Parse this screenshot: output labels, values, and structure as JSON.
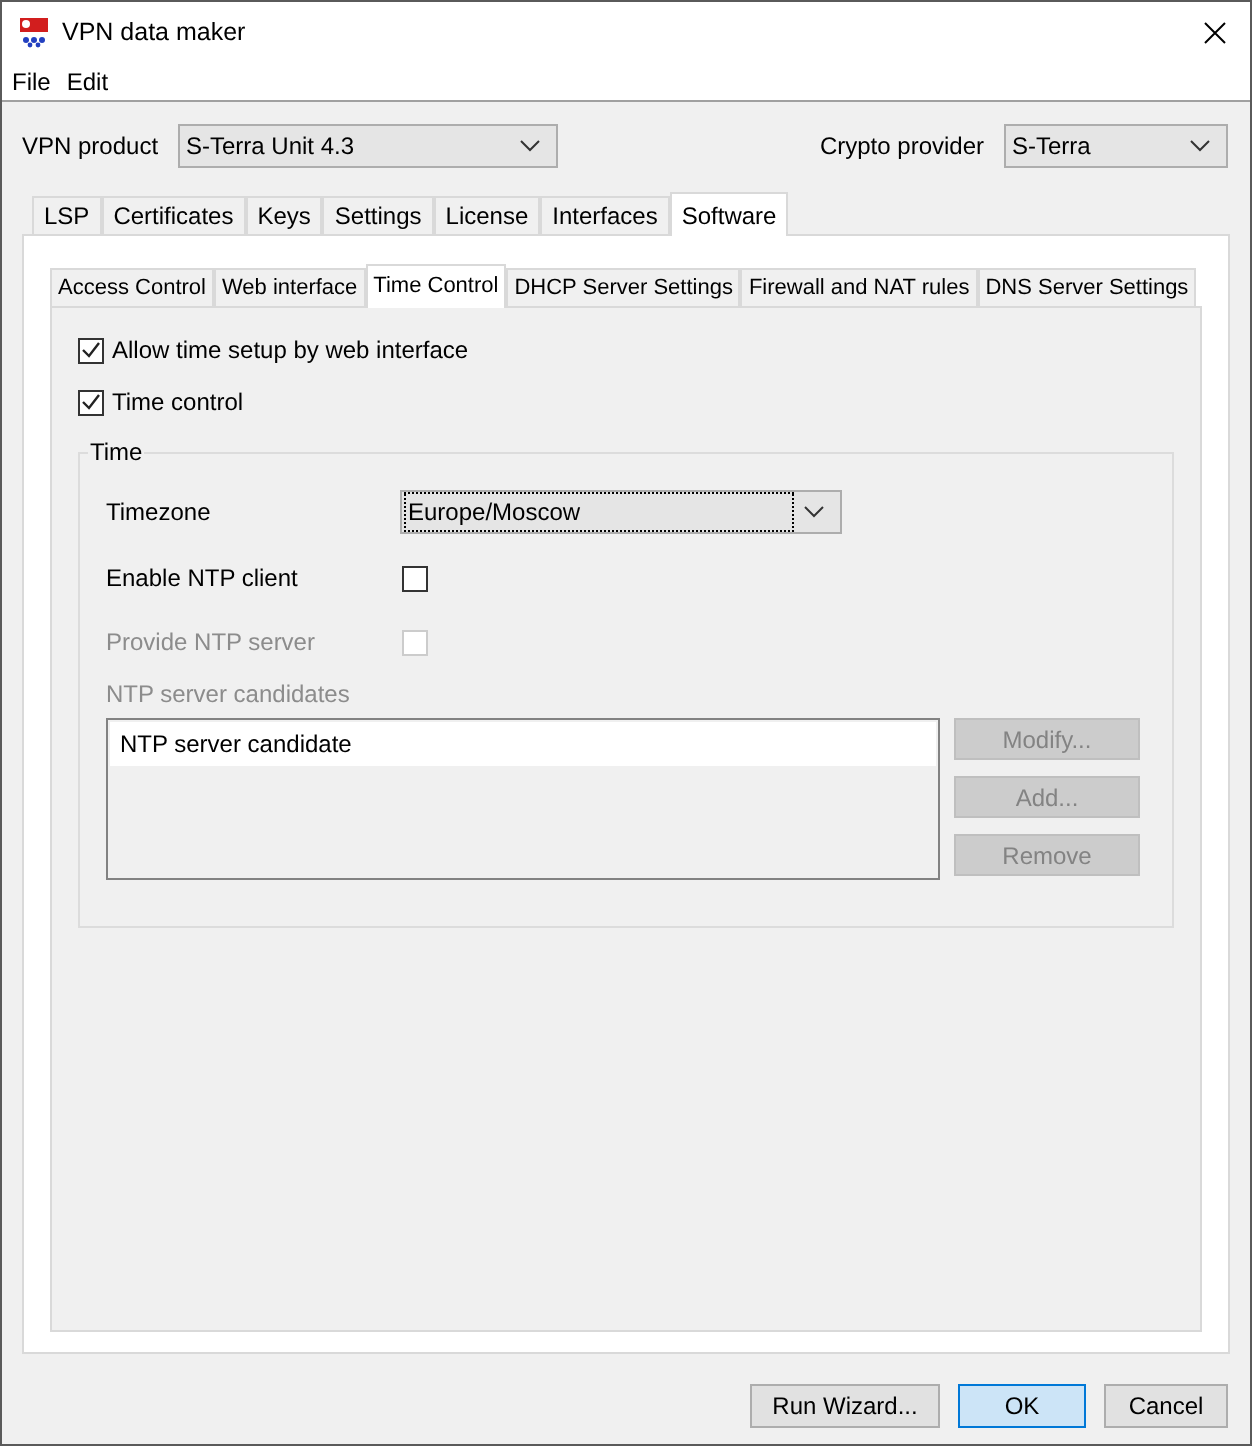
{
  "window": {
    "title": "VPN data maker"
  },
  "menu": [
    "File",
    "Edit"
  ],
  "vpn_product": {
    "label": "VPN product",
    "value": "S-Terra Unit 4.3"
  },
  "crypto_provider": {
    "label": "Crypto provider",
    "value": "S-Terra"
  },
  "tabs": [
    {
      "label": "LSP",
      "selected": false
    },
    {
      "label": "Certificates",
      "selected": false
    },
    {
      "label": "Keys",
      "selected": false
    },
    {
      "label": "Settings",
      "selected": false
    },
    {
      "label": "License",
      "selected": false
    },
    {
      "label": "Interfaces",
      "selected": false
    },
    {
      "label": "Software",
      "selected": true
    }
  ],
  "subtabs": [
    {
      "label": "Access Control",
      "selected": false
    },
    {
      "label": "Web interface",
      "selected": false
    },
    {
      "label": "Time Control",
      "selected": true
    },
    {
      "label": "DHCP Server Settings",
      "selected": false
    },
    {
      "label": "Firewall and NAT rules",
      "selected": false
    },
    {
      "label": "DNS Server Settings",
      "selected": false
    }
  ],
  "options": [
    {
      "label": "Allow time setup by web interface",
      "checked": true
    },
    {
      "label": "Time control",
      "checked": true
    }
  ],
  "time_group": {
    "title": "Time",
    "timezone": {
      "label": "Timezone",
      "value": "Europe/Moscow"
    },
    "ntp_client": {
      "label": "Enable NTP client",
      "checked": false,
      "disabled": false
    },
    "ntp_server": {
      "label": "Provide NTP server",
      "checked": false,
      "disabled": true
    },
    "candidates": {
      "label": "NTP server candidates",
      "disabled": true,
      "items": [
        "NTP server candidate"
      ],
      "buttons": [
        {
          "label": "Modify...",
          "disabled": true
        },
        {
          "label": "Add...",
          "disabled": true
        },
        {
          "label": "Remove",
          "disabled": true
        }
      ]
    }
  },
  "footer_buttons": [
    {
      "label": "Run Wizard...",
      "default": false
    },
    {
      "label": "OK",
      "default": true
    },
    {
      "label": "Cancel",
      "default": false
    }
  ]
}
